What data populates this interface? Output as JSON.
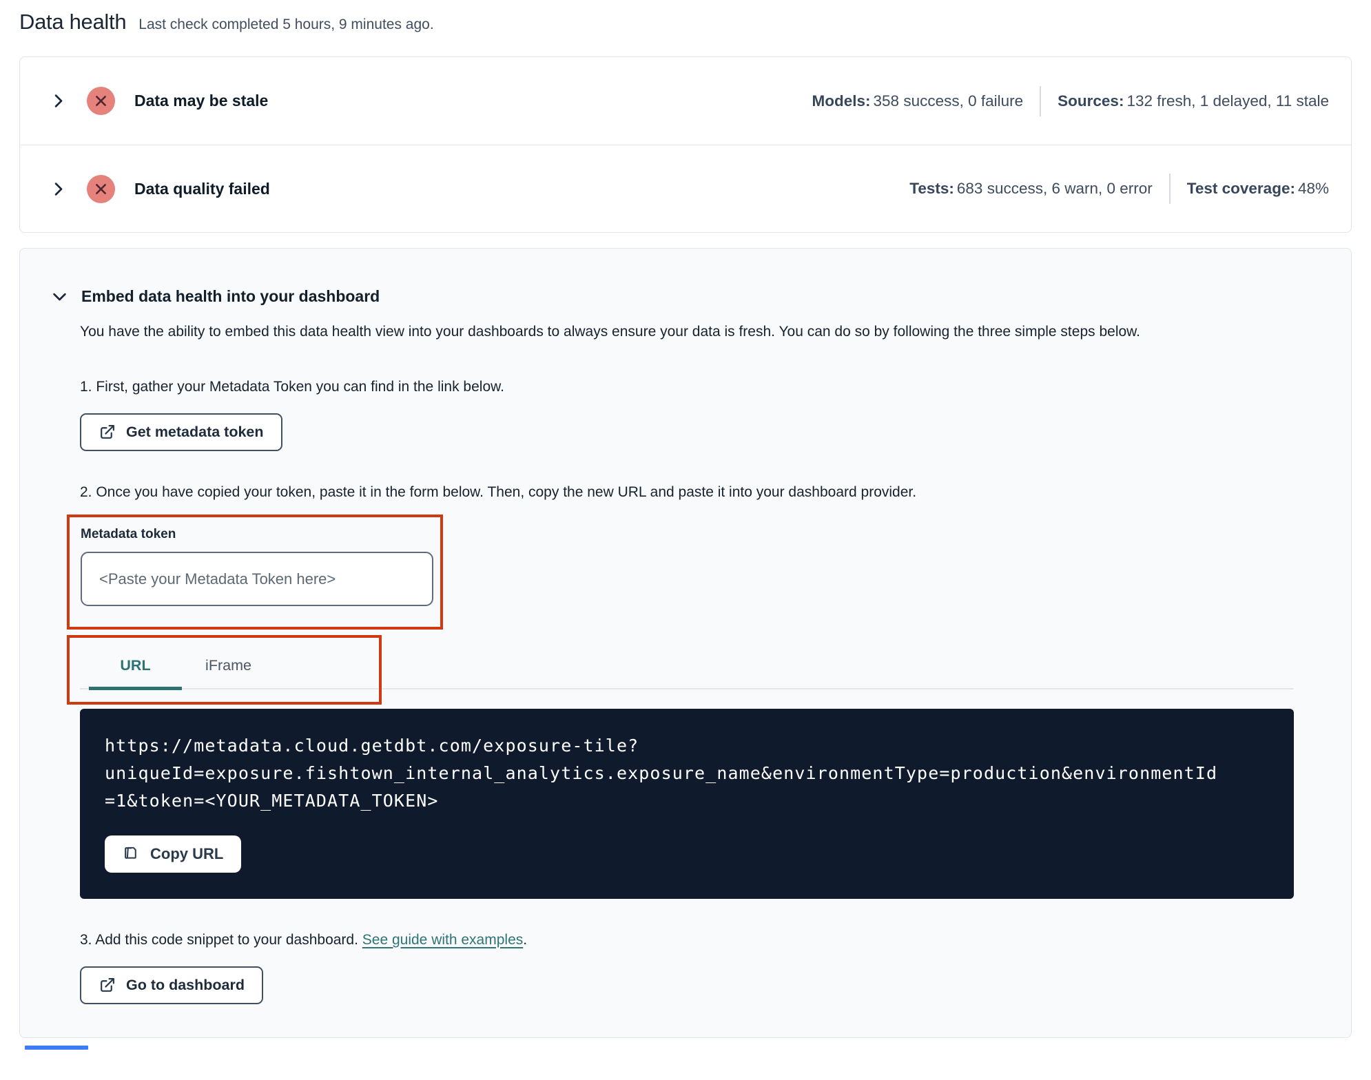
{
  "page": {
    "title": "Data health",
    "subtitle": "Last check completed 5 hours, 9 minutes ago."
  },
  "status_rows": [
    {
      "title": "Data may be stale",
      "status_icon": "x-circle-icon",
      "stats": [
        {
          "label": "Models:",
          "value": "358 success, 0 failure"
        },
        {
          "label": "Sources:",
          "value": "132 fresh, 1 delayed, 11 stale"
        }
      ]
    },
    {
      "title": "Data quality failed",
      "status_icon": "x-circle-icon",
      "stats": [
        {
          "label": "Tests:",
          "value": "683 success, 6 warn, 0 error"
        },
        {
          "label": "Test coverage:",
          "value": "48%"
        }
      ]
    }
  ],
  "embed": {
    "title": "Embed data health into your dashboard",
    "description": "You have the ability to embed this data health view into your dashboards to always ensure your data is fresh. You can do so by following the three simple steps below.",
    "step1": {
      "text": "1. First, gather your Metadata Token you can find in the link below.",
      "button_label": "Get metadata token"
    },
    "step2": {
      "text": "2. Once you have copied your token, paste it in the form below. Then, copy the new URL and paste it into your dashboard provider.",
      "token_label": "Metadata token",
      "token_placeholder": "<Paste your Metadata Token here>",
      "token_value": "",
      "tabs": [
        {
          "label": "URL"
        },
        {
          "label": "iFrame"
        }
      ],
      "active_tab": "URL",
      "code_url": "https://metadata.cloud.getdbt.com/exposure-tile?uniqueId=exposure.fishtown_internal_analytics.exposure_name&environmentType=production&environmentId=1&token=<YOUR_METADATA_TOKEN>",
      "code_lines": {
        "line1": "https://metadata.cloud.getdbt.com/exposure-tile?",
        "line2": "uniqueId=exposure.fishtown_internal_analytics.exposure_name&environmentType=production&environmentId",
        "line3": "=1&token=<YOUR_METADATA_TOKEN>"
      },
      "copy_button_label": "Copy URL"
    },
    "step3": {
      "text_before_link": "3. Add this code snippet to your dashboard. ",
      "link_label": "See guide with examples",
      "text_after_link": ".",
      "button_label": "Go to dashboard"
    }
  },
  "icons": {
    "chevron_right": "chevron-right-icon",
    "chevron_down": "chevron-down-icon",
    "x_circle": "x-circle-icon",
    "external_link": "external-link-icon",
    "copy": "copy-icon"
  },
  "colors": {
    "annotation_red": "#d13a10",
    "status_badge_red": "#e5827b",
    "status_badge_x": "#4e2530",
    "accent_teal": "#2e7173",
    "code_background": "#0f1b2c",
    "card_border": "#e1e4e8",
    "section_background": "#f9fafb",
    "text_dark": "#1e2937"
  }
}
